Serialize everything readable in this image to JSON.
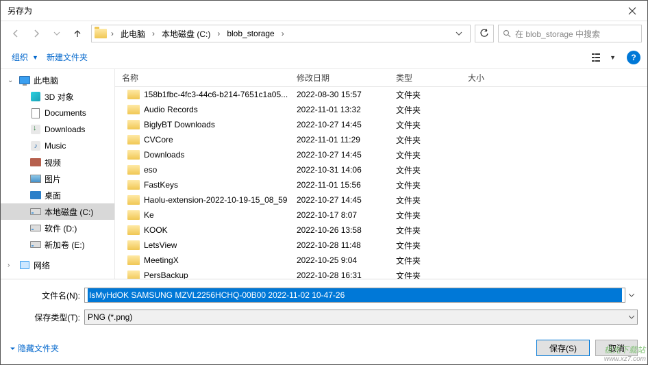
{
  "title": "另存为",
  "breadcrumb": [
    "此电脑",
    "本地磁盘 (C:)",
    "blob_storage"
  ],
  "search_placeholder": "在 blob_storage 中搜索",
  "toolbar": {
    "organize": "组织",
    "new_folder": "新建文件夹"
  },
  "sidebar": {
    "root": "此电脑",
    "items": [
      {
        "label": "3D 对象",
        "icon": "3d"
      },
      {
        "label": "Documents",
        "icon": "doc"
      },
      {
        "label": "Downloads",
        "icon": "dl"
      },
      {
        "label": "Music",
        "icon": "music"
      },
      {
        "label": "视频",
        "icon": "vid"
      },
      {
        "label": "图片",
        "icon": "img"
      },
      {
        "label": "桌面",
        "icon": "desk"
      },
      {
        "label": "本地磁盘 (C:)",
        "icon": "disk",
        "selected": true
      },
      {
        "label": "软件 (D:)",
        "icon": "disk"
      },
      {
        "label": "新加卷 (E:)",
        "icon": "disk"
      }
    ],
    "network": "网络"
  },
  "columns": {
    "name": "名称",
    "date": "修改日期",
    "type": "类型",
    "size": "大小"
  },
  "files": [
    {
      "name": "158b1fbc-4fc3-44c6-b214-7651c1a05...",
      "date": "2022-08-30 15:57",
      "type": "文件夹"
    },
    {
      "name": "Audio Records",
      "date": "2022-11-01 13:32",
      "type": "文件夹"
    },
    {
      "name": "BiglyBT Downloads",
      "date": "2022-10-27 14:45",
      "type": "文件夹"
    },
    {
      "name": "CVCore",
      "date": "2022-11-01 11:29",
      "type": "文件夹"
    },
    {
      "name": "Downloads",
      "date": "2022-10-27 14:45",
      "type": "文件夹"
    },
    {
      "name": "eso",
      "date": "2022-10-31 14:06",
      "type": "文件夹"
    },
    {
      "name": "FastKeys",
      "date": "2022-11-01 15:56",
      "type": "文件夹"
    },
    {
      "name": "Haolu-extension-2022-10-19-15_08_59",
      "date": "2022-10-27 14:45",
      "type": "文件夹"
    },
    {
      "name": "Ke",
      "date": "2022-10-17 8:07",
      "type": "文件夹"
    },
    {
      "name": "KOOK",
      "date": "2022-10-26 13:58",
      "type": "文件夹"
    },
    {
      "name": "LetsView",
      "date": "2022-10-28 11:48",
      "type": "文件夹"
    },
    {
      "name": "MeetingX",
      "date": "2022-10-25 9:04",
      "type": "文件夹"
    },
    {
      "name": "PersBackup",
      "date": "2022-10-28 16:31",
      "type": "文件夹"
    }
  ],
  "bottom": {
    "filename_label": "文件名(N):",
    "filename_value": "IsMyHdOK SAMSUNG MZVL2256HCHQ-00B00 2022-11-02 10-47-26",
    "filetype_label": "保存类型(T):",
    "filetype_value": "PNG (*.png)"
  },
  "footer": {
    "hide_folders": "隐藏文件夹",
    "save": "保存(S)",
    "cancel": "取消"
  },
  "watermark": {
    "line1": "极光下载站",
    "line2": "www.xz7.com"
  }
}
